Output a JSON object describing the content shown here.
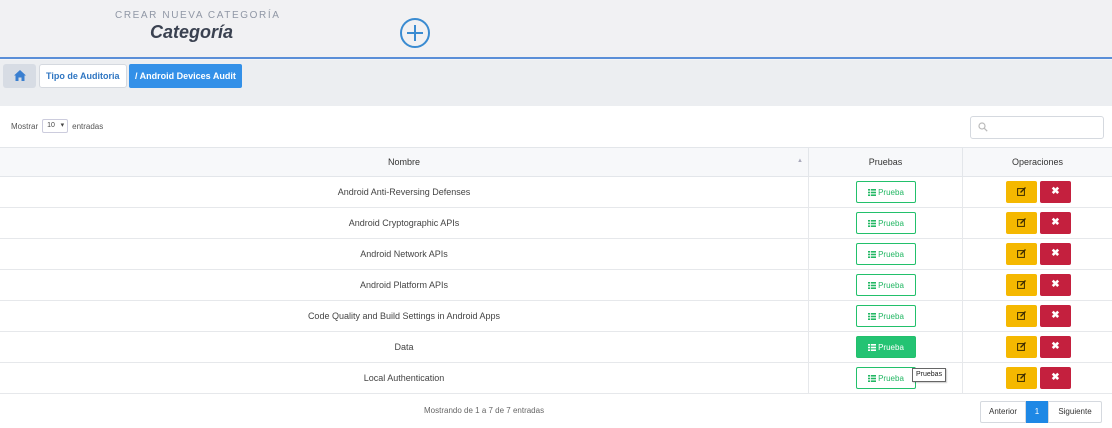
{
  "header": {
    "subtitle": "CREAR NUEVA CATEGORÍA",
    "title": "Categoría",
    "add_icon": "plus-circle-icon"
  },
  "breadcrumb": {
    "home_icon": "home-icon",
    "tipo": "Tipo de Auditoria",
    "active": "/ Android Devices Audit"
  },
  "table_controls": {
    "show_label": "Mostrar",
    "page_size": "10",
    "entries_label": "entradas",
    "search_placeholder": ""
  },
  "columns": [
    "Nombre",
    "Pruebas",
    "Operaciones"
  ],
  "rows": [
    {
      "name": "Android Anti-Reversing Defenses",
      "button": "Prueba"
    },
    {
      "name": "Android Cryptographic APIs",
      "button": "Prueba"
    },
    {
      "name": "Android Network APIs",
      "button": "Prueba"
    },
    {
      "name": "Android Platform APIs",
      "button": "Prueba"
    },
    {
      "name": "Code Quality and Build Settings in Android Apps",
      "button": "Prueba"
    },
    {
      "name": "Data",
      "button": "Prueba"
    },
    {
      "name": "Local Authentication",
      "button": "Prueba"
    }
  ],
  "hovered_row": 5,
  "tooltip": "Pruebas",
  "footer": {
    "info": "Mostrando de 1 a 7 de 7 entradas",
    "prev": "Anterior",
    "current_page": "1",
    "next": "Siguiente"
  },
  "colors": {
    "accent": "#1e88e5",
    "success": "#24c373",
    "warning": "#f5b800",
    "danger": "#c4203e"
  }
}
